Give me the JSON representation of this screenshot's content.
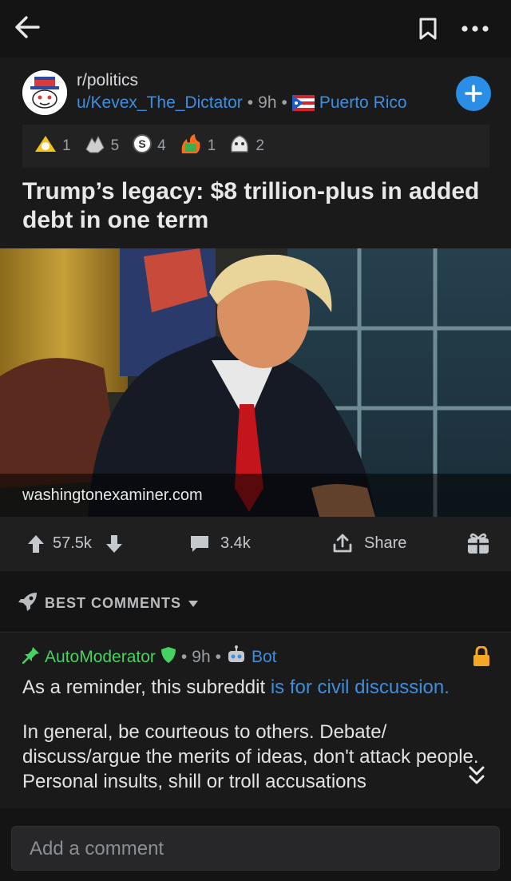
{
  "post": {
    "subreddit": "r/politics",
    "author": "u/Kevex_The_Dictator",
    "age": "9h",
    "location": "Puerto Rico",
    "awards": [
      {
        "icon": "silver-award-icon",
        "count": "1"
      },
      {
        "icon": "hands-award-icon",
        "count": "5"
      },
      {
        "icon": "coin-award-icon",
        "count": "4"
      },
      {
        "icon": "fire-award-icon",
        "count": "1"
      },
      {
        "icon": "face-award-icon",
        "count": "2"
      }
    ],
    "title": "Trump’s legacy: $8 trillion-plus in added debt in one term",
    "domain": "washingtonexaminer.com",
    "score": "57.5k",
    "comments": "3.4k",
    "share_label": "Share"
  },
  "sort_label": "BEST COMMENTS",
  "comment": {
    "author": "AutoModerator",
    "age": "9h",
    "flair": "Bot",
    "line1_prefix": "As a reminder, this subreddit ",
    "line1_link": "is for civil discussion.",
    "paragraph2": "In general, be courteous to others. Debate/ discuss/argue the merits of ideas, don't attack people. Personal insults, shill or troll accusations"
  },
  "composer": {
    "placeholder": "Add a comment"
  },
  "colors": {
    "accent": "#3e8ee0",
    "lock": "#f5a623",
    "mod": "#46d160"
  }
}
